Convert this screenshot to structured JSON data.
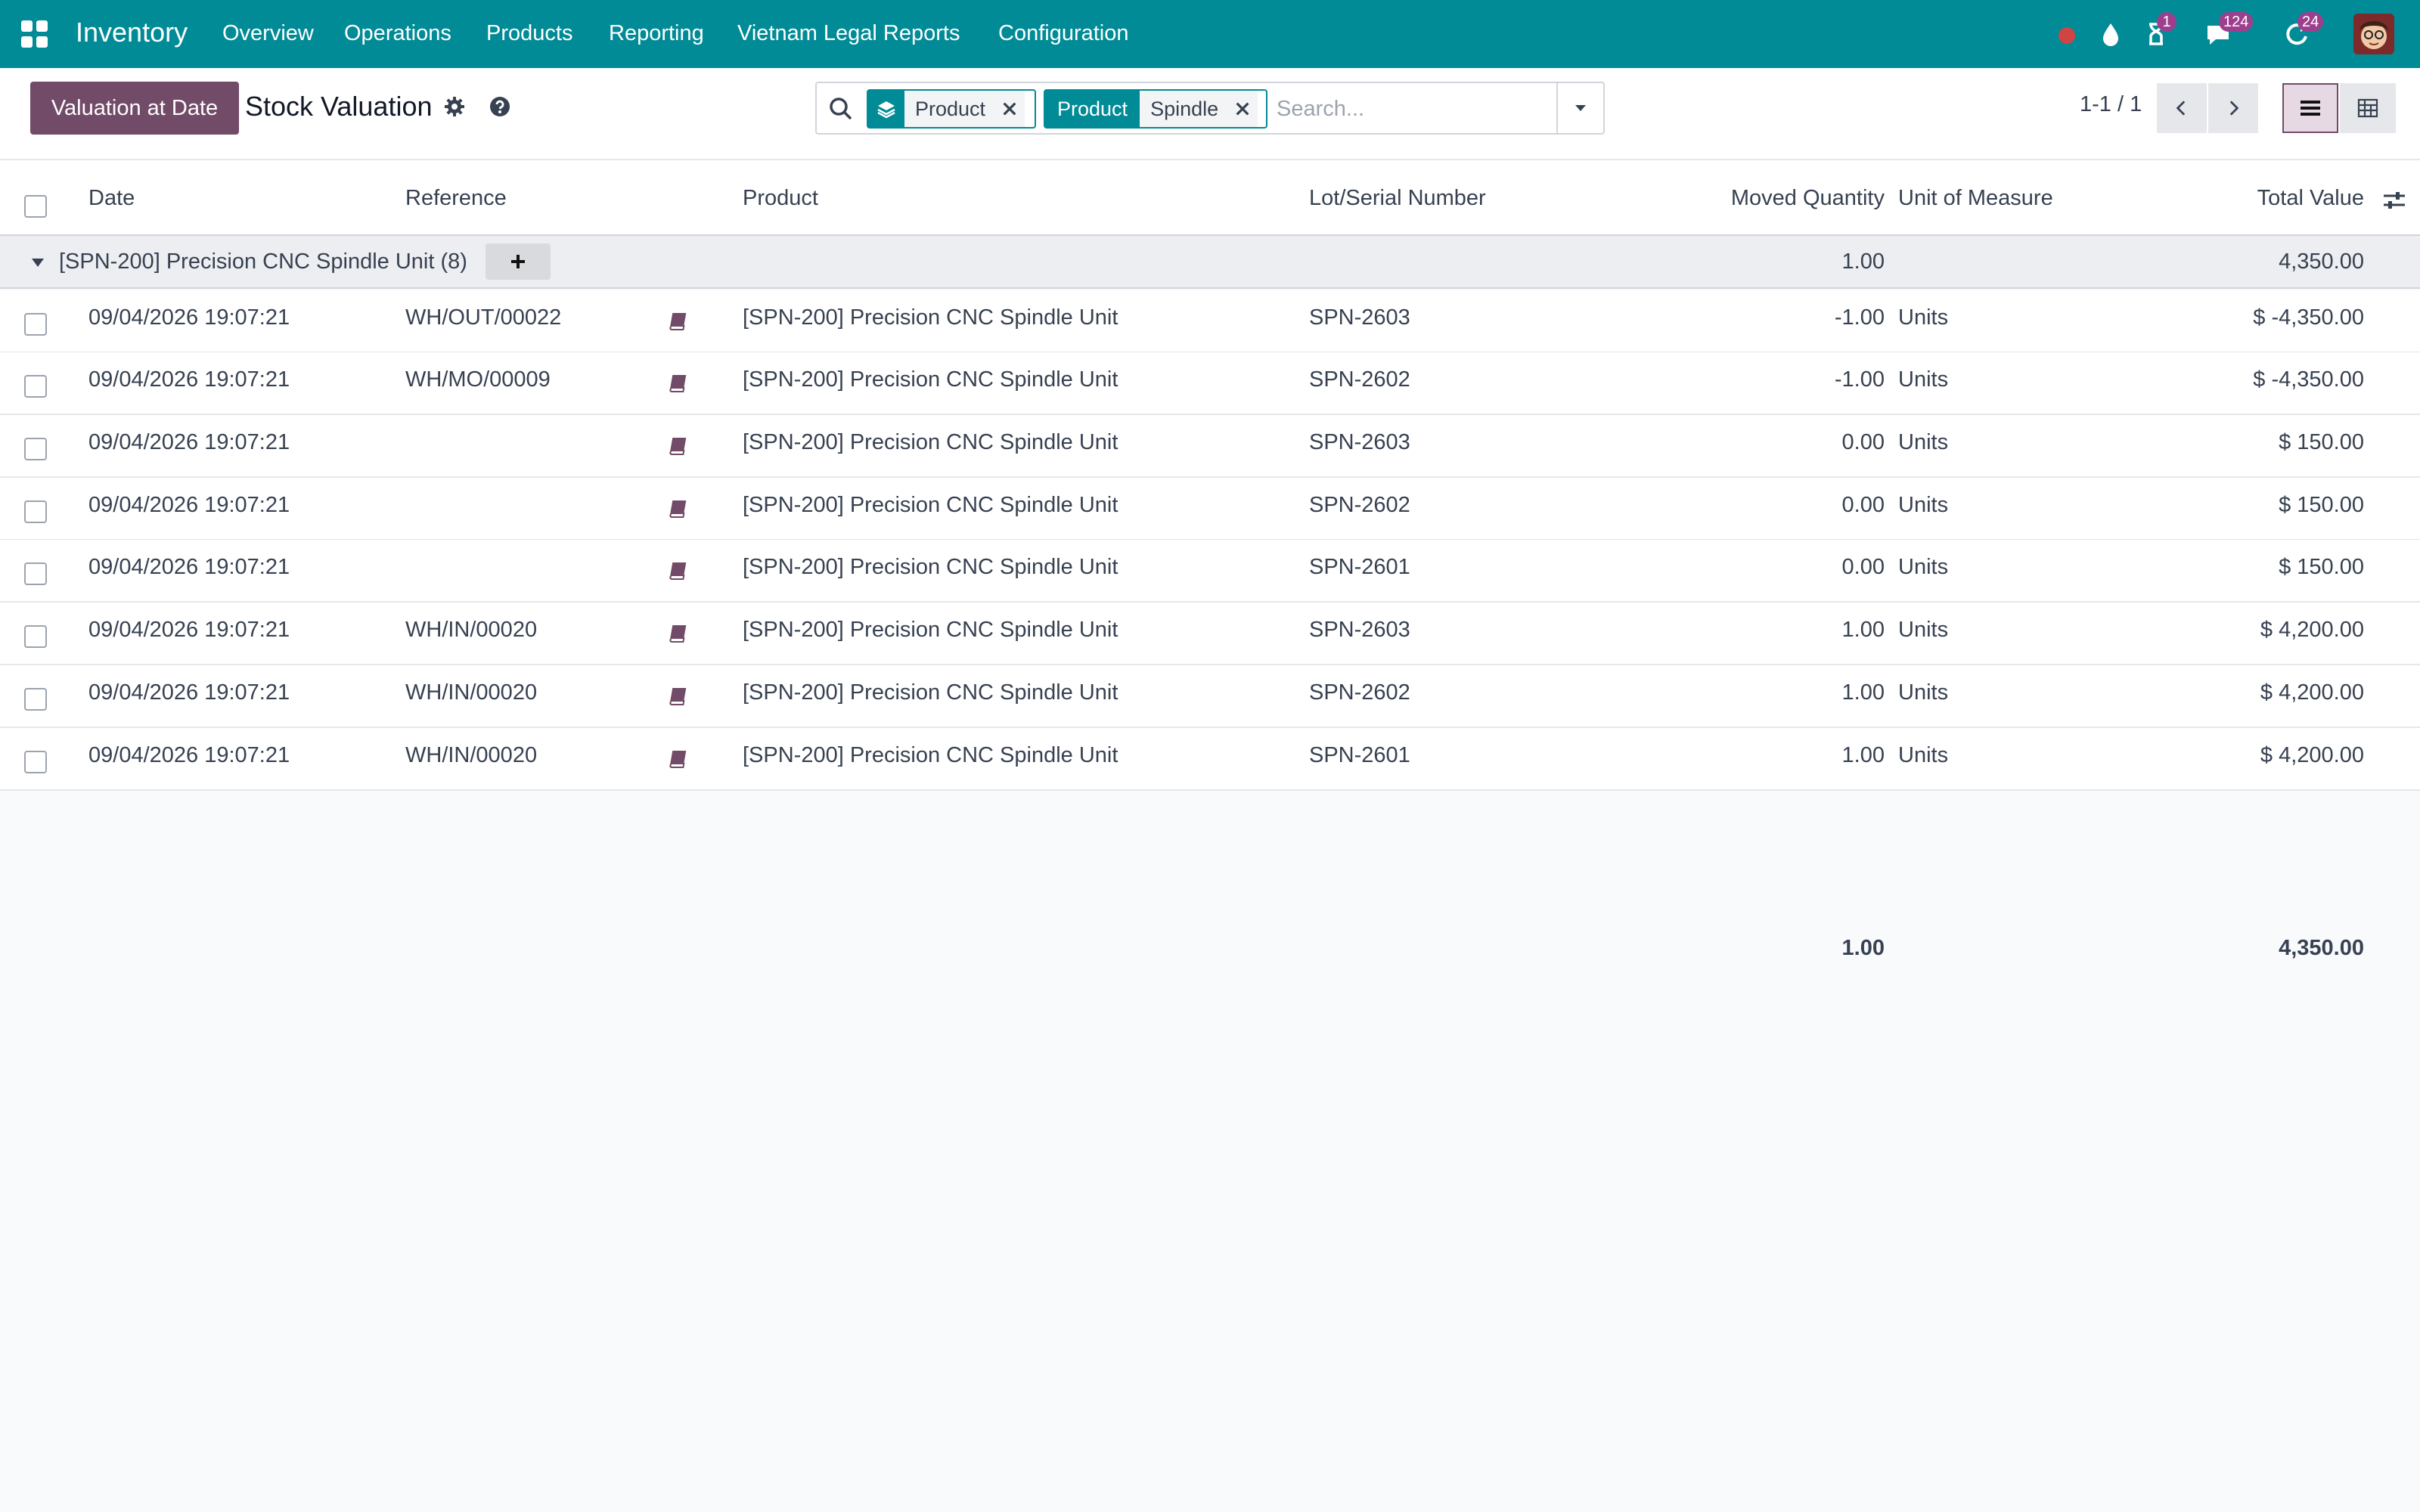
{
  "nav": {
    "brand": "Inventory",
    "menu": [
      "Overview",
      "Operations",
      "Products",
      "Reporting",
      "Vietnam Legal Reports",
      "Configuration"
    ],
    "activity_badge": "1",
    "messages_badge": "124",
    "updates_badge": "24",
    "icons": [
      "apps-icon",
      "record-icon",
      "droplet-icon",
      "hourglass-icon",
      "chat-icon",
      "refresh-icon",
      "avatar"
    ]
  },
  "control": {
    "primary_button": "Valuation at Date",
    "title": "Stock Valuation",
    "facet1_value": "Product",
    "facet2_label": "Product",
    "facet2_value": "Spindle",
    "search_placeholder": "Search...",
    "pager": "1-1 / 1"
  },
  "table": {
    "headers": [
      "Date",
      "Reference",
      "Product",
      "Lot/Serial Number",
      "Moved Quantity",
      "Unit of Measure",
      "Total Value"
    ],
    "group": {
      "label": "[SPN-200] Precision CNC Spindle Unit (8)",
      "quantity": "1.00",
      "value": "4,350.00"
    },
    "rows": [
      {
        "date": "09/04/2026 19:07:21",
        "reference": "WH/OUT/00022",
        "product": "[SPN-200] Precision CNC Spindle Unit",
        "lot": "SPN-2603",
        "qty": "-1.00",
        "uom": "Units",
        "value": "$ -4,350.00"
      },
      {
        "date": "09/04/2026 19:07:21",
        "reference": "WH/MO/00009",
        "product": "[SPN-200] Precision CNC Spindle Unit",
        "lot": "SPN-2602",
        "qty": "-1.00",
        "uom": "Units",
        "value": "$ -4,350.00"
      },
      {
        "date": "09/04/2026 19:07:21",
        "reference": "",
        "product": "[SPN-200] Precision CNC Spindle Unit",
        "lot": "SPN-2603",
        "qty": "0.00",
        "uom": "Units",
        "value": "$ 150.00"
      },
      {
        "date": "09/04/2026 19:07:21",
        "reference": "",
        "product": "[SPN-200] Precision CNC Spindle Unit",
        "lot": "SPN-2602",
        "qty": "0.00",
        "uom": "Units",
        "value": "$ 150.00"
      },
      {
        "date": "09/04/2026 19:07:21",
        "reference": "",
        "product": "[SPN-200] Precision CNC Spindle Unit",
        "lot": "SPN-2601",
        "qty": "0.00",
        "uom": "Units",
        "value": "$ 150.00"
      },
      {
        "date": "09/04/2026 19:07:21",
        "reference": "WH/IN/00020",
        "product": "[SPN-200] Precision CNC Spindle Unit",
        "lot": "SPN-2603",
        "qty": "1.00",
        "uom": "Units",
        "value": "$ 4,200.00"
      },
      {
        "date": "09/04/2026 19:07:21",
        "reference": "WH/IN/00020",
        "product": "[SPN-200] Precision CNC Spindle Unit",
        "lot": "SPN-2602",
        "qty": "1.00",
        "uom": "Units",
        "value": "$ 4,200.00"
      },
      {
        "date": "09/04/2026 19:07:21",
        "reference": "WH/IN/00020",
        "product": "[SPN-200] Precision CNC Spindle Unit",
        "lot": "SPN-2601",
        "qty": "1.00",
        "uom": "Units",
        "value": "$ 4,200.00"
      }
    ],
    "footer": {
      "quantity": "1.00",
      "value": "4,350.00"
    }
  },
  "colors": {
    "navbar": "#018b96",
    "primary": "#714b67",
    "badge": "#9d3f8e",
    "book_icon": "#714b67"
  }
}
